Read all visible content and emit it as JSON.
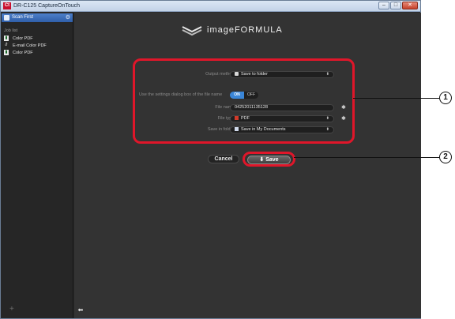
{
  "window": {
    "title": "DR-C125 CaptureOnTouch",
    "app_icon_label": "Ct",
    "buttons": {
      "minimize": "–",
      "maximize": "□",
      "close": "✕"
    }
  },
  "sidebar": {
    "scan_first": "Scan First",
    "job_list_label": "Job list",
    "jobs": [
      {
        "label": "Color PDF",
        "icon": "pdf-icon"
      },
      {
        "label": "E-mail Color PDF",
        "icon": "paperclip-icon"
      },
      {
        "label": "Color PDF",
        "icon": "pdf-icon"
      }
    ],
    "add_label": "+"
  },
  "brand": {
    "name": "imageFORMULA"
  },
  "settings": {
    "output_method": {
      "label": "Output method:",
      "value": "Save to folder"
    },
    "use_settings_dialog": {
      "label": "Use the settings dialog box of the file name",
      "on": "ON",
      "off": "OFF"
    },
    "file_name": {
      "label": "File name:",
      "value": "04252011135128"
    },
    "file_type": {
      "label": "File type:",
      "value": "PDF"
    },
    "save_in_folder": {
      "label": "Save in folder:",
      "value": "Save in My Documents"
    }
  },
  "actions": {
    "cancel": "Cancel",
    "save": "Save"
  },
  "callouts": {
    "one": "1",
    "two": "2"
  },
  "colors": {
    "highlight": "#e0162a",
    "accent": "#3a86d8"
  }
}
